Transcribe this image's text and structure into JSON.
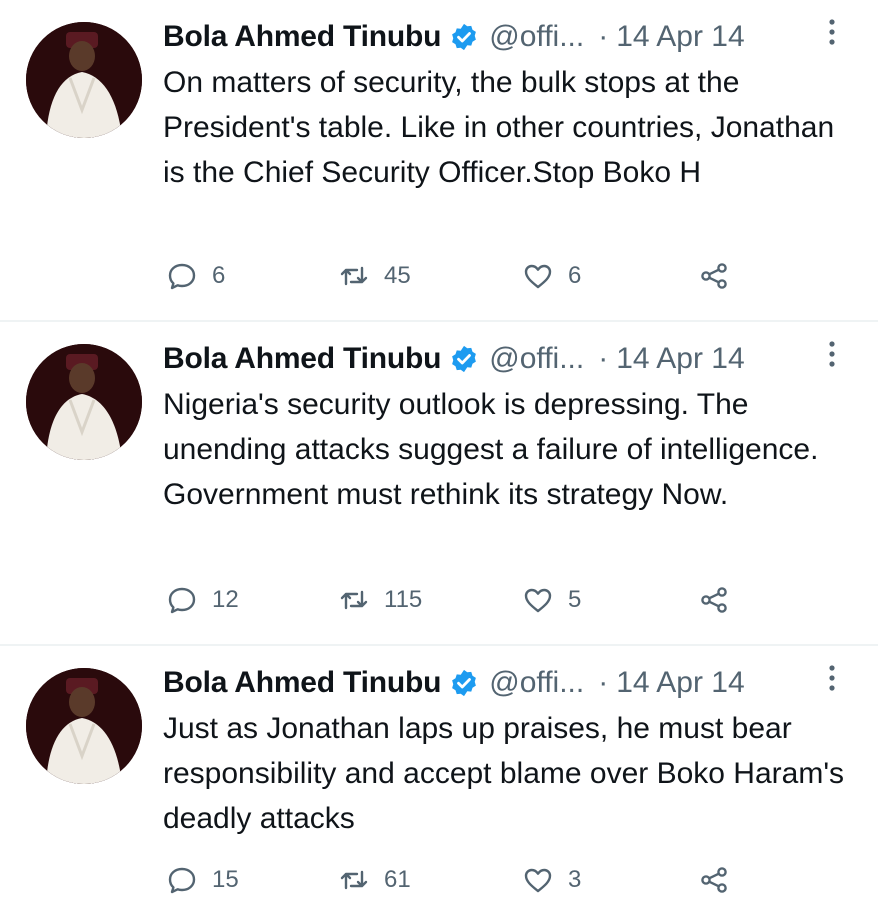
{
  "colors": {
    "name_text": "#0f1419",
    "secondary_text": "#536471",
    "verified_badge": "#1d9bf0",
    "divider": "#eff3f4"
  },
  "icons": {
    "reply": "speech-bubble",
    "retweet": "retweet-arrows",
    "like": "heart-outline",
    "share": "share-nodes",
    "more": "vertical-dots",
    "verified": "verified-badge"
  },
  "tweets": [
    {
      "author": "Bola Ahmed Tinubu",
      "handle": "@offi...",
      "separator": "·",
      "date": "14 Apr 14",
      "text": "On matters of security, the bulk stops at the President's table. Like in other countries, Jonathan is the Chief Security Officer.Stop Boko H",
      "replies": "6",
      "retweets": "45",
      "likes": "6"
    },
    {
      "author": "Bola Ahmed Tinubu",
      "handle": "@offi...",
      "separator": "·",
      "date": "14 Apr 14",
      "text": "Nigeria's security outlook is depressing. The unending attacks suggest a failure of intelligence. Government must rethink its strategy Now.",
      "replies": "12",
      "retweets": "115",
      "likes": "5"
    },
    {
      "author": "Bola Ahmed Tinubu",
      "handle": "@offi...",
      "separator": "·",
      "date": "14 Apr 14",
      "text": "Just as Jonathan laps up praises, he must bear responsibility and accept blame over Boko Haram's deadly attacks",
      "replies": "15",
      "retweets": "61",
      "likes": "3"
    }
  ]
}
